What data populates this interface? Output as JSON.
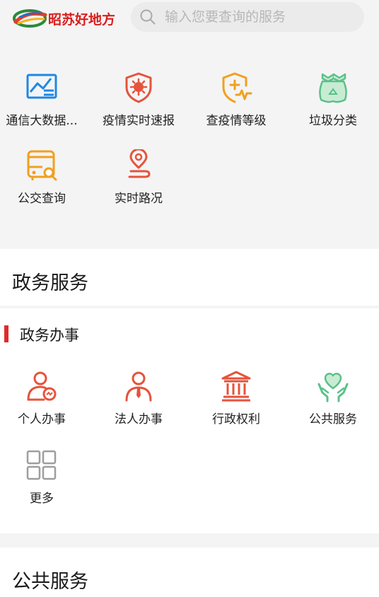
{
  "header": {
    "logo_text": "昭苏好地方",
    "search_placeholder": "输入您要查询的服务"
  },
  "quick_services": [
    {
      "label": "通信大数据...",
      "icon": "chart-data-icon"
    },
    {
      "label": "疫情实时速报",
      "icon": "virus-shield-icon"
    },
    {
      "label": "查疫情等级",
      "icon": "medical-shield-icon"
    },
    {
      "label": "垃圾分类",
      "icon": "recycle-bag-icon"
    },
    {
      "label": "公交查询",
      "icon": "bus-search-icon"
    },
    {
      "label": "实时路况",
      "icon": "location-route-icon"
    }
  ],
  "gov_section": {
    "title": "政务服务",
    "subsection_title": "政务办事",
    "items": [
      {
        "label": "个人办事",
        "icon": "person-icon"
      },
      {
        "label": "法人办事",
        "icon": "legal-person-icon"
      },
      {
        "label": "行政权利",
        "icon": "government-building-icon"
      },
      {
        "label": "公共服务",
        "icon": "heart-hands-icon"
      },
      {
        "label": "更多",
        "icon": "grid-more-icon"
      }
    ]
  },
  "public_section": {
    "title": "公共服务"
  },
  "colors": {
    "brand_red": "#d81e1e",
    "accent_blue": "#1e88e5",
    "icon_red": "#e5533b",
    "icon_orange": "#f0a020",
    "icon_green": "#5cc08a",
    "icon_gray": "#9e9e9e"
  }
}
